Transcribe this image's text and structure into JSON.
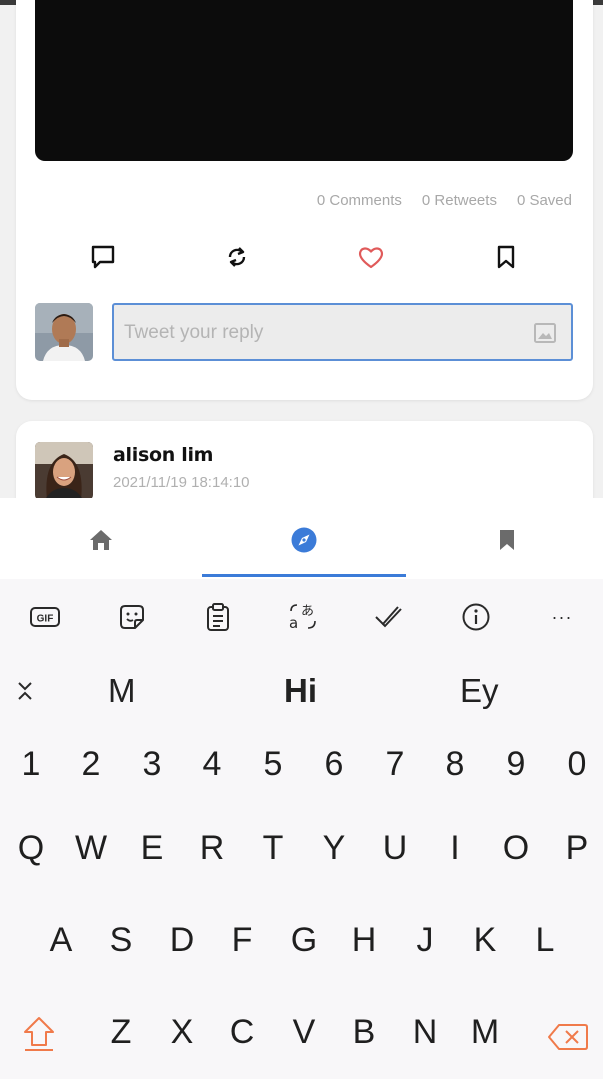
{
  "post": {
    "counts": {
      "comments": "0 Comments",
      "retweets": "0 Retweets",
      "saved": "0 Saved"
    },
    "reply_placeholder": "Tweet your reply"
  },
  "next_post": {
    "username": "alison lim",
    "timestamp": "2021/11/19 18:14:10"
  },
  "colors": {
    "accent": "#3b7bd8",
    "heart": "#e05a5a",
    "keyboard_accent": "#f07a4a"
  },
  "bottom_nav": {
    "items": [
      "home-icon",
      "explore-compass-icon",
      "bookmark-icon"
    ],
    "active": "explore-compass-icon"
  },
  "keyboard": {
    "toolbar": [
      "gif-icon",
      "sticker-icon",
      "clipboard-icon",
      "translate-icon",
      "grammar-check-icon",
      "info-icon",
      "more-icon"
    ],
    "gif_label": "GIF",
    "more_label": "···",
    "suggestions": [
      "M",
      "Hi",
      "Ey"
    ],
    "rows": {
      "numbers": [
        "1",
        "2",
        "3",
        "4",
        "5",
        "6",
        "7",
        "8",
        "9",
        "0"
      ],
      "row1": [
        "Q",
        "W",
        "E",
        "R",
        "T",
        "Y",
        "U",
        "I",
        "O",
        "P"
      ],
      "row2": [
        "A",
        "S",
        "D",
        "F",
        "G",
        "H",
        "J",
        "K",
        "L"
      ],
      "row3": [
        "Z",
        "X",
        "C",
        "V",
        "B",
        "N",
        "M"
      ]
    }
  }
}
